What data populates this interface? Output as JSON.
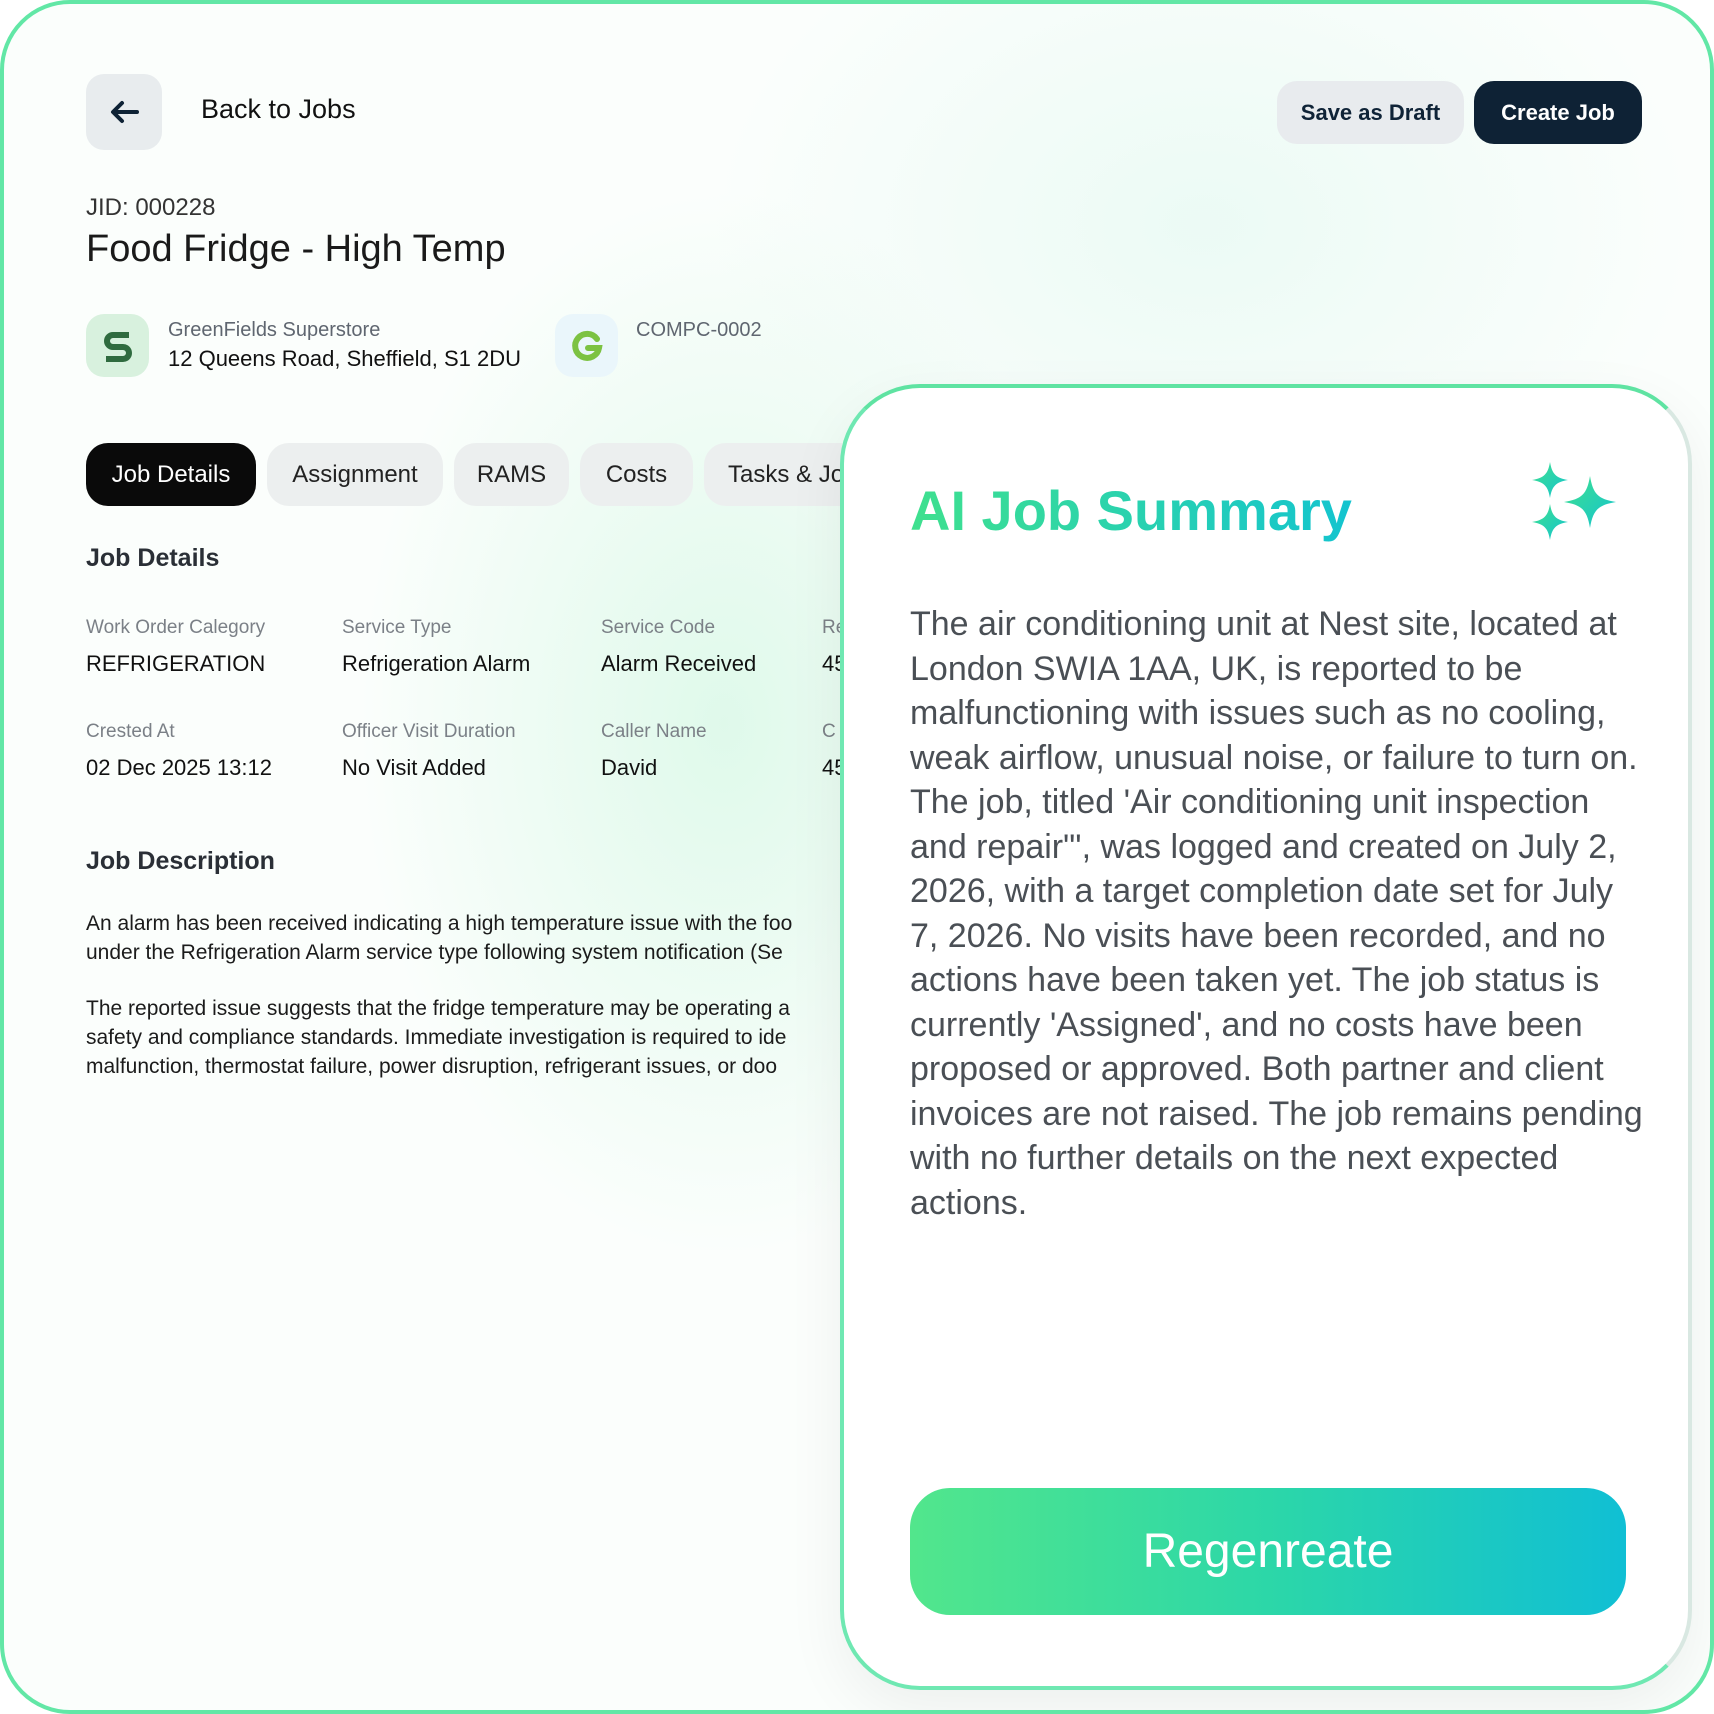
{
  "header": {
    "back_label": "Back to Jobs",
    "save_draft_label": "Save as Draft",
    "create_job_label": "Create Job"
  },
  "job": {
    "jid": "JID: 000228",
    "title": "Food Fridge - High Temp"
  },
  "site": {
    "name": "GreenFields Superstore",
    "address": "12 Queens Road, Sheffield, S1 2DU",
    "company_code": "COMPC-0002",
    "logo_s_color": "#2f6b3f",
    "logo_g_color": "#7cc242"
  },
  "tabs": [
    {
      "label": "Job Details",
      "active": true
    },
    {
      "label": "Assignment",
      "active": false
    },
    {
      "label": "RAMS",
      "active": false
    },
    {
      "label": "Costs",
      "active": false
    },
    {
      "label": "Tasks & Jo",
      "active": false
    }
  ],
  "details": {
    "heading": "Job Details",
    "fields": [
      {
        "label": "Work Order Calegory",
        "value": "REFRIGERATION"
      },
      {
        "label": "Service Type",
        "value": "Refrigeration Alarm"
      },
      {
        "label": "Service Code",
        "value": "Alarm Received"
      },
      {
        "label": "Re",
        "value": "45"
      },
      {
        "label": "Crested At",
        "value": "02 Dec 2025 13:12"
      },
      {
        "label": "Officer Visit Duration",
        "value": "No Visit Added"
      },
      {
        "label": "Caller Name",
        "value": "David"
      },
      {
        "label": "C",
        "value": "45"
      }
    ]
  },
  "description": {
    "heading": "Job Description",
    "lines": [
      "An alarm has been received indicating a high temperature issue with the foo",
      "under the Refrigeration Alarm service type following system notification (Se",
      "The reported issue suggests that the fridge temperature may be operating a",
      "safety and compliance standards. Immediate investigation is required to ide",
      "malfunction, thermostat failure, power disruption, refrigerant issues, or doo"
    ]
  },
  "ai_summary": {
    "title": "AI Job Summary",
    "text": "The air conditioning unit at Nest site, located at London SWIA 1AA, UK, is reported to be malfunctioning with issues such as no cooling, weak airflow, unusual noise, or failure to turn on. The job, titled 'Air conditioning unit inspection and repair\"', was logged and created on July 2, 2026, with a target completion date set for July 7, 2026. No visits have been recorded, and no actions have been taken yet. The job status is currently 'Assigned', and no costs have been proposed or approved. Both partner and client invoices are not raised. The job remains pending with no further details on the next expected actions.",
    "regenerate_label": "Regenreate"
  },
  "colors": {
    "accent_green": "#3fe08e",
    "accent_teal": "#14c4cf",
    "dark_navy": "#0e2235"
  }
}
